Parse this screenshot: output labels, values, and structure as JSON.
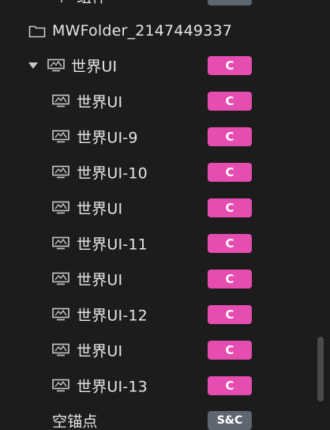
{
  "tree": {
    "top_partial": {
      "label": "组件",
      "badge": ""
    },
    "folder": {
      "label": "MWFolder_2147449337",
      "icon": "folder-icon"
    },
    "parent": {
      "label": "世界UI",
      "badge": "C",
      "icon": "ui-widget-icon",
      "expanded": true
    },
    "children": [
      {
        "label": "世界UI",
        "badge": "C"
      },
      {
        "label": "世界UI-9",
        "badge": "C"
      },
      {
        "label": "世界UI-10",
        "badge": "C"
      },
      {
        "label": "世界UI",
        "badge": "C"
      },
      {
        "label": "世界UI-11",
        "badge": "C"
      },
      {
        "label": "世界UI",
        "badge": "C"
      },
      {
        "label": "世界UI-12",
        "badge": "C"
      },
      {
        "label": "世界UI",
        "badge": "C"
      },
      {
        "label": "世界UI-13",
        "badge": "C"
      }
    ],
    "bottom": {
      "label": "空锚点",
      "badge": "S&C"
    }
  },
  "colors": {
    "background": "#1c1c1c",
    "badge_client": "#e64db0",
    "badge_shared": "#5e6670",
    "text": "#e6e6e6"
  }
}
